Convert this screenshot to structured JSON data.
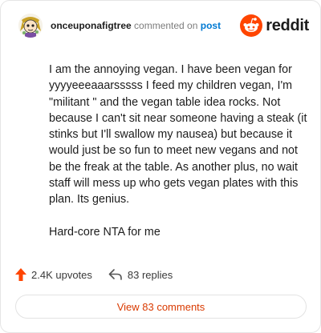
{
  "header": {
    "username": "onceuponafigtree",
    "verb": "commented on",
    "target": "post",
    "brand": "reddit"
  },
  "comment": {
    "paragraphs": [
      "I am the annoying vegan. I have been vegan for yyyyeeeaaarsssss I feed my children vegan, I'm \"militant \" and the vegan table idea rocks. Not because I can't sit near someone having a steak (it stinks but I'll swallow my nausea) but because it would just be so fun to meet new vegans and not be the freak at the table. As another plus, no wait staff will mess up who gets vegan plates with this plan. Its genius.",
      "Hard-core NTA for me"
    ]
  },
  "actions": {
    "upvotes": "2.4K upvotes",
    "replies": "83 replies"
  },
  "view_button": "View 83 comments",
  "colors": {
    "brand": "#ff4500",
    "link": "#0079d3",
    "view_text": "#d93a00"
  },
  "icons": [
    "avatar-image",
    "reddit-logo-icon",
    "upvote-arrow-icon",
    "reply-arrow-icon"
  ]
}
